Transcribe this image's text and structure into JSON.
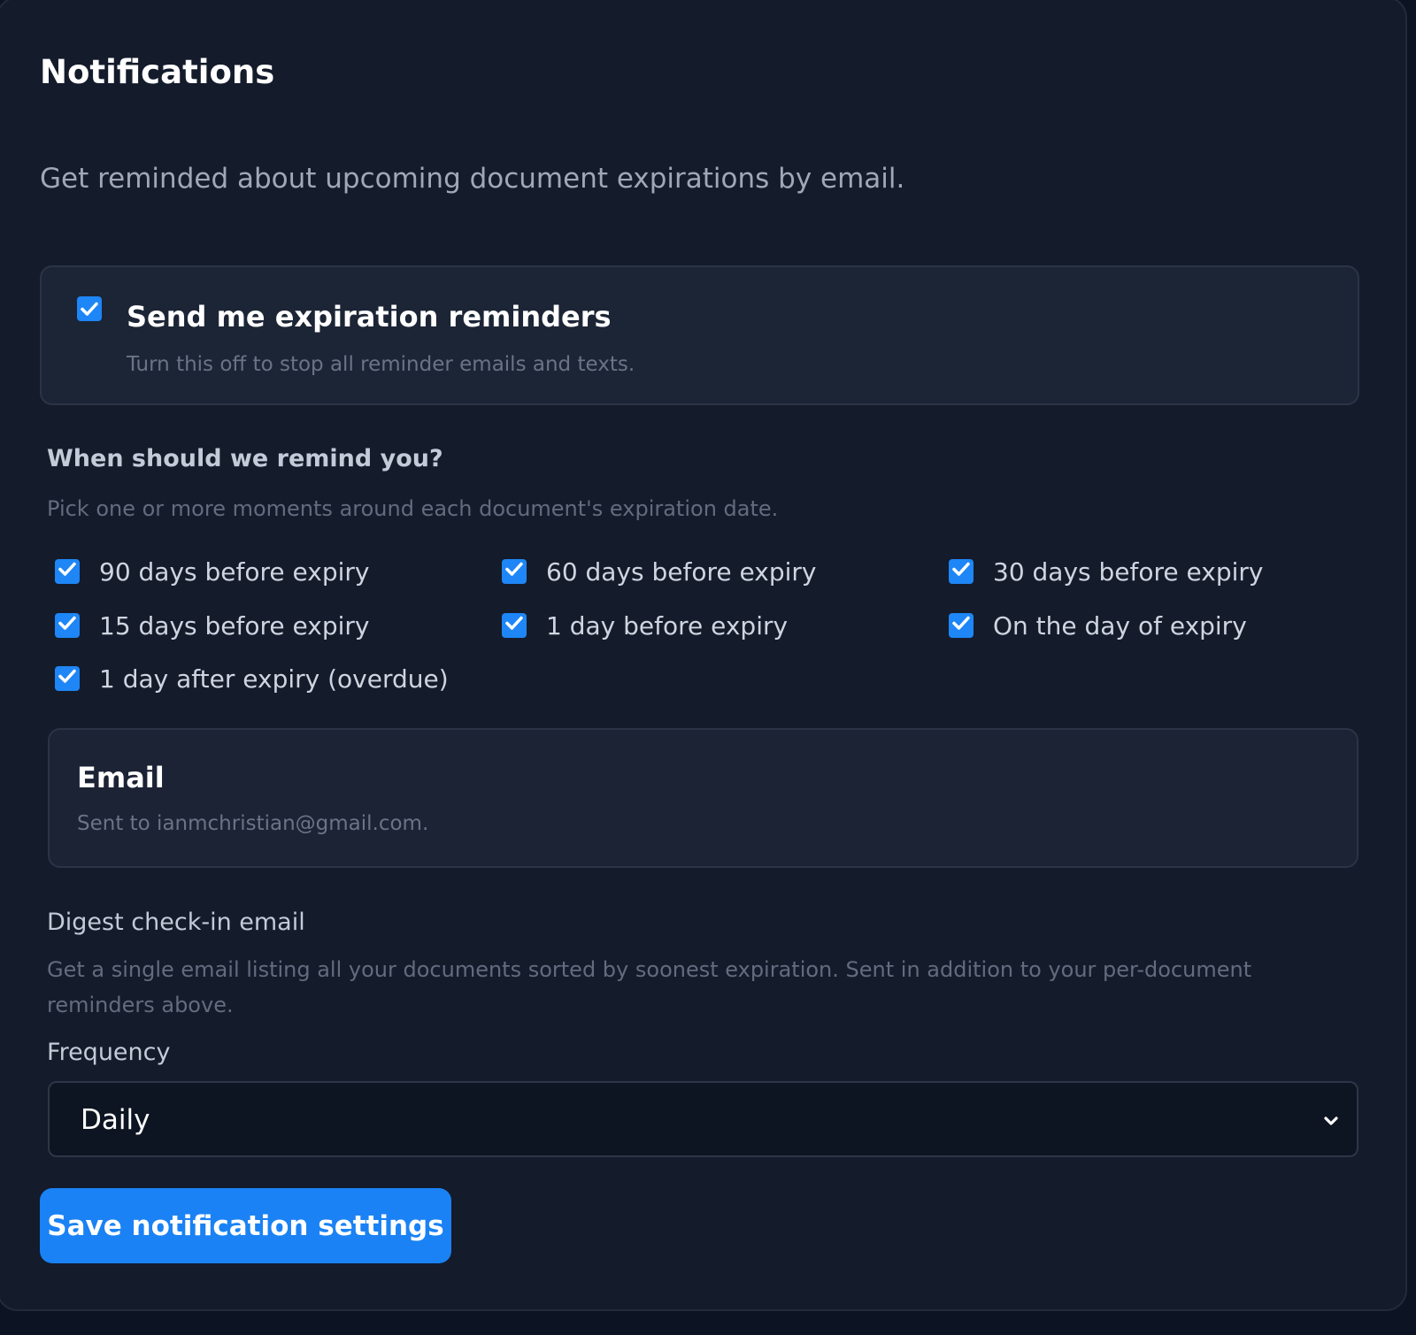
{
  "header": {
    "title": "Notifications",
    "intro": "Get reminded about upcoming document expirations by email."
  },
  "master": {
    "label": "Send me expiration reminders",
    "hint": "Turn this off to stop all reminder emails and texts.",
    "checked": true
  },
  "timing": {
    "title": "When should we remind you?",
    "hint": "Pick one or more moments around each document's expiration date.",
    "options": [
      {
        "label": "90 days before expiry",
        "checked": true
      },
      {
        "label": "60 days before expiry",
        "checked": true
      },
      {
        "label": "30 days before expiry",
        "checked": true
      },
      {
        "label": "15 days before expiry",
        "checked": true
      },
      {
        "label": "1 day before expiry",
        "checked": true
      },
      {
        "label": "On the day of expiry",
        "checked": true
      },
      {
        "label": "1 day after expiry (overdue)",
        "checked": true
      }
    ]
  },
  "email": {
    "title": "Email",
    "hint": "Sent to ianmchristian@gmail.com."
  },
  "digest": {
    "title": "Digest check-in email",
    "hint_line1": "Get a single email listing all your documents sorted by soonest expiration. Sent in addition to your per-document",
    "hint_line2": "reminders above.",
    "frequency_label": "Frequency",
    "frequency_value": "Daily"
  },
  "actions": {
    "save_label": "Save notification settings"
  },
  "colors": {
    "accent": "#1a82f4",
    "card_bg": "#141b2b",
    "page_bg": "#0c1424"
  }
}
